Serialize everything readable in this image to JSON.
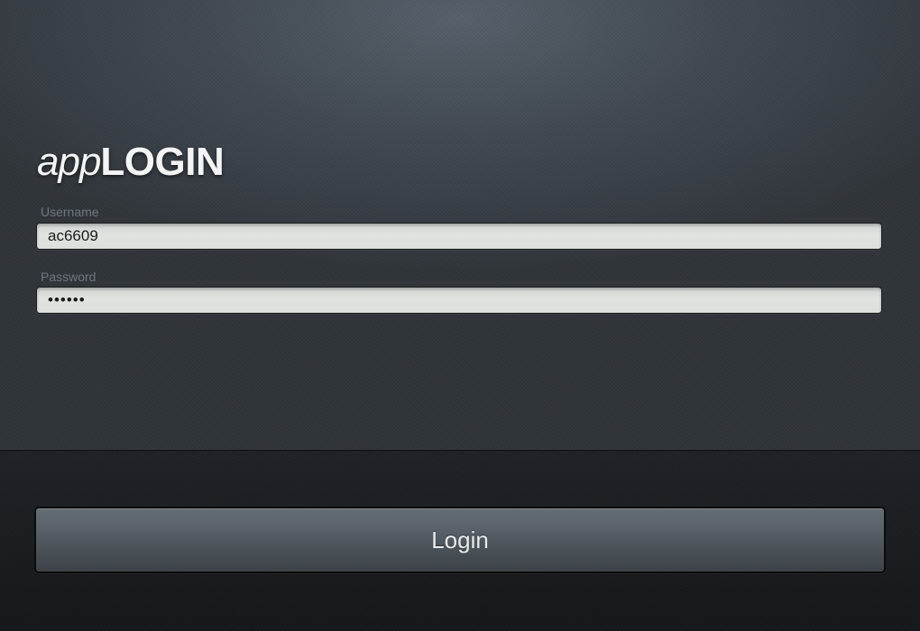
{
  "logo": {
    "light_text": "app",
    "bold_text": "LOGIN"
  },
  "form": {
    "username_label": "Username",
    "username_value": "ac6609",
    "password_label": "Password",
    "password_value": "••••••"
  },
  "actions": {
    "login_label": "Login"
  },
  "colors": {
    "background_top": "#424a52",
    "background_bottom": "#1a1d20",
    "input_fill": "#dde1de",
    "button_fill": "#565e65",
    "label_text": "#6f777e"
  }
}
